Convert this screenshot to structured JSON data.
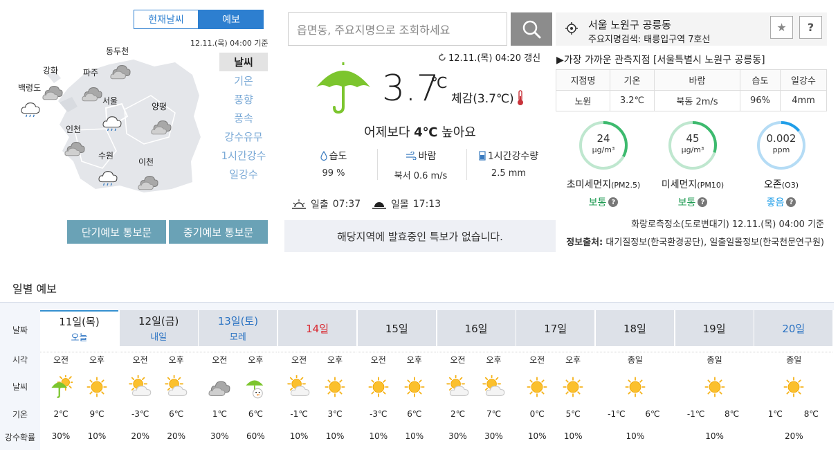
{
  "map": {
    "tabs": [
      "현재날씨",
      "예보"
    ],
    "base_time": "12.11.(목) 04:00 기준",
    "cities": [
      {
        "name": "백령도",
        "icon": "rain-cloud-icon"
      },
      {
        "name": "강화",
        "icon": "cloud-icon"
      },
      {
        "name": "파주",
        "icon": "cloud-icon"
      },
      {
        "name": "동두천",
        "icon": "cloud-icon"
      },
      {
        "name": "서울",
        "icon": "rain-cloud-icon"
      },
      {
        "name": "양평",
        "icon": "cloud-icon"
      },
      {
        "name": "인천",
        "icon": "cloud-icon"
      },
      {
        "name": "수원",
        "icon": "rain-cloud-icon"
      },
      {
        "name": "이천",
        "icon": "cloud-icon"
      }
    ],
    "layers": [
      "날씨",
      "기온",
      "풍향",
      "풍속",
      "강수유무",
      "1시간강수",
      "일강수"
    ],
    "bulletins": [
      "단기예보 통보문",
      "중기예보 통보문"
    ]
  },
  "current": {
    "search_placeholder": "읍면동, 주요지명으로 조회하세요",
    "updated": "12.11.(목) 04:20 갱신",
    "temperature": "3.7",
    "unit": "℃",
    "feels_like": "체감(3.7℃)",
    "compare_prefix": "어제보다 ",
    "compare_value": "4℃",
    "compare_suffix": " 높아요",
    "weather_icon": "umbrella-icon",
    "metrics": [
      {
        "label": "습도",
        "value": "99 %",
        "icon": "droplet-icon"
      },
      {
        "label": "바람",
        "value": "북서 0.6 m/s",
        "icon": "wind-icon"
      },
      {
        "label": "1시간강수량",
        "value": "2.5 mm",
        "icon": "rain-gauge-icon"
      }
    ],
    "sunrise_label": "일출",
    "sunrise": "07:37",
    "sunset_label": "일몰",
    "sunset": "17:13",
    "alert": "해당지역에 발효중인 특보가 없습니다."
  },
  "location": {
    "name": "서울 노원구 공릉동",
    "sub": "주요지명검색: 태릉입구역 7호선",
    "star_label": "★",
    "help_label": "?"
  },
  "observation": {
    "title": "▶가장 가까운 관측지점 [서울특별시 노원구 공릉동]",
    "headers": [
      "지점명",
      "기온",
      "바람",
      "습도",
      "일강수"
    ],
    "values": [
      "노원",
      "3.2℃",
      "북동 2m/s",
      "96%",
      "4mm"
    ]
  },
  "air": [
    {
      "value": "24",
      "unit": "μg/m³",
      "label": "초미세먼지",
      "label_small": "(PM2.5)",
      "status": "보통",
      "fraction": 0.33,
      "color": "#3dba6e"
    },
    {
      "value": "45",
      "unit": "μg/m³",
      "label": "미세먼지",
      "label_small": "(PM10)",
      "status": "보통",
      "fraction": 0.3,
      "color": "#3dba6e"
    },
    {
      "value": "0.002",
      "unit": "ppm",
      "label": "오존",
      "label_small": "(O3)",
      "status": "좋음",
      "fraction": 0.14,
      "color": "#1f9ee8"
    }
  ],
  "sources": {
    "air_station": "화랑로측정소(도로변대기) 12.11.(목) 04:00 기준",
    "source_label": "정보출처:",
    "source_text": " 대기질정보(한국환경공단), 일출일몰정보(한국천문연구원)"
  },
  "daily": {
    "title": "일별 예보",
    "row_labels": [
      "날짜",
      "시각",
      "날씨",
      "기온",
      "강수확률"
    ],
    "days": [
      {
        "name": "11일(목)",
        "sub": "오늘",
        "name_color": "#222222",
        "split": true,
        "times": [
          "오전",
          "오후"
        ],
        "icons": [
          "umbrella-icon",
          "sun-icon"
        ],
        "temps": [
          "2℃",
          "9℃"
        ],
        "pops": [
          "30%",
          "10%"
        ]
      },
      {
        "name": "12일(금)",
        "sub": "내일",
        "name_color": "#222222",
        "split": true,
        "times": [
          "오전",
          "오후"
        ],
        "icons": [
          "partly-cloudy-icon",
          "partly-cloudy-icon"
        ],
        "temps": [
          "-3℃",
          "6℃"
        ],
        "pops": [
          "20%",
          "20%"
        ]
      },
      {
        "name": "13일(토)",
        "sub": "모레",
        "name_color": "#2a72c2",
        "split": true,
        "times": [
          "오전",
          "오후"
        ],
        "icons": [
          "cloud-icon",
          "umbrella-snow-icon"
        ],
        "temps": [
          "1℃",
          "6℃"
        ],
        "pops": [
          "30%",
          "60%"
        ]
      },
      {
        "name": "14일",
        "sub": "",
        "name_color": "#d9262e",
        "split": true,
        "times": [
          "오전",
          "오후"
        ],
        "icons": [
          "partly-cloudy-icon",
          "sun-icon"
        ],
        "temps": [
          "-1℃",
          "3℃"
        ],
        "pops": [
          "10%",
          "10%"
        ]
      },
      {
        "name": "15일",
        "sub": "",
        "name_color": "#222222",
        "split": true,
        "times": [
          "오전",
          "오후"
        ],
        "icons": [
          "sun-icon",
          "sun-icon"
        ],
        "temps": [
          "-3℃",
          "6℃"
        ],
        "pops": [
          "10%",
          "10%"
        ]
      },
      {
        "name": "16일",
        "sub": "",
        "name_color": "#222222",
        "split": true,
        "times": [
          "오전",
          "오후"
        ],
        "icons": [
          "partly-cloudy-icon",
          "partly-cloudy-icon"
        ],
        "temps": [
          "2℃",
          "7℃"
        ],
        "pops": [
          "30%",
          "30%"
        ]
      },
      {
        "name": "17일",
        "sub": "",
        "name_color": "#222222",
        "split": true,
        "times": [
          "오전",
          "오후"
        ],
        "icons": [
          "sun-icon",
          "sun-icon"
        ],
        "temps": [
          "0℃",
          "5℃"
        ],
        "pops": [
          "10%",
          "10%"
        ]
      },
      {
        "name": "18일",
        "sub": "",
        "name_color": "#222222",
        "split": false,
        "times": [
          "종일"
        ],
        "icons": [
          "sun-icon"
        ],
        "temps": [
          "-1℃",
          "6℃"
        ],
        "pops": [
          "10%"
        ]
      },
      {
        "name": "19일",
        "sub": "",
        "name_color": "#222222",
        "split": false,
        "times": [
          "종일"
        ],
        "icons": [
          "sun-icon"
        ],
        "temps": [
          "-1℃",
          "8℃"
        ],
        "pops": [
          "10%"
        ]
      },
      {
        "name": "20일",
        "sub": "",
        "name_color": "#2a72c2",
        "split": false,
        "times": [
          "종일"
        ],
        "icons": [
          "sun-icon"
        ],
        "temps": [
          "1℃",
          "8℃"
        ],
        "pops": [
          "20%"
        ]
      }
    ]
  }
}
